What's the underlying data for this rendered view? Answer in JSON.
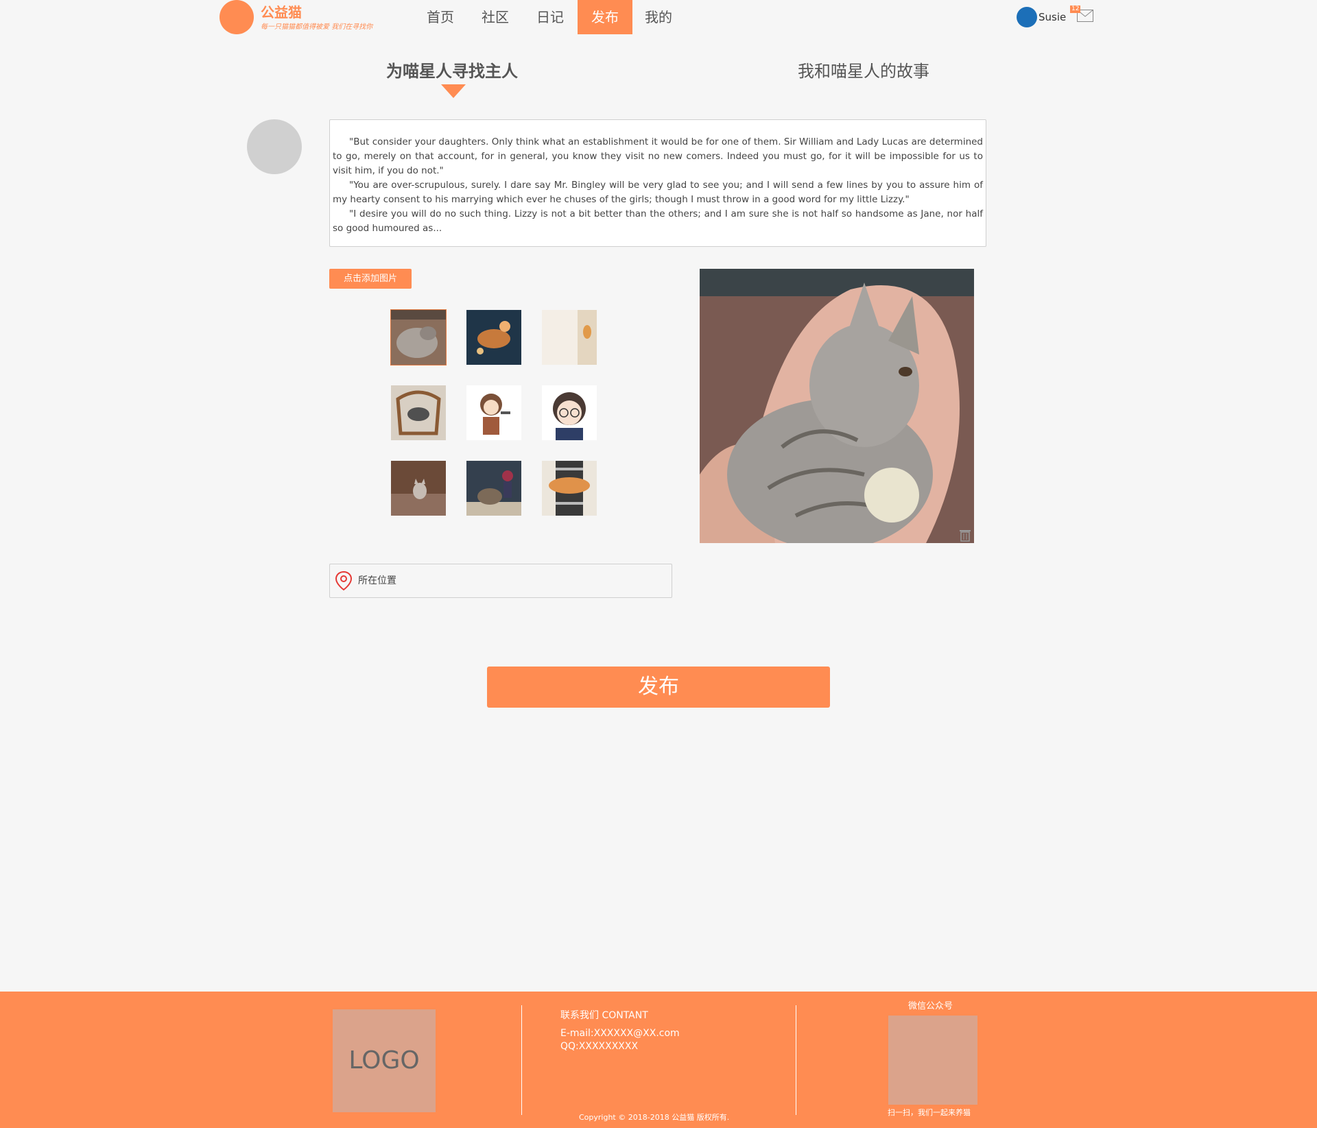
{
  "header": {
    "brand_name": "公益猫",
    "brand_slogan": "每一只猫猫都值得被爱 我们在寻找你",
    "nav": [
      "首页",
      "社区",
      "日记",
      "发布",
      "我的"
    ],
    "active_nav": "发布",
    "user_name": "Susie",
    "mail_badge": "12"
  },
  "tabs": {
    "find_owner": "为喵星人寻找主人",
    "stories": "我和喵星人的故事"
  },
  "post": {
    "paragraphs": [
      "\"But consider your daughters. Only think what an establishment it would be for one of them. Sir William and Lady Lucas are determined to go, merely on that account, for in general, you know they visit no new comers. Indeed you must go, for it will be impossible for us to visit him, if you do not.\"",
      "\"You are over-scrupulous, surely. I dare say Mr. Bingley will be very glad to see you; and I will send a few lines by you to assure him of my hearty consent to his marrying which ever he chuses of the girls; though I must throw in a good word for my little Lizzy.\"",
      "\"I desire you will do no such thing. Lizzy is not a bit better than the others; and I am sure she is not half so handsome as Jane, nor half so good humoured as..."
    ],
    "add_image_label": "点击添加图片",
    "location_placeholder": "所在位置",
    "publish_label": "发布"
  },
  "gallery": {
    "thumbnails": [
      "tabby-cat-photo",
      "cat-in-lights-photo",
      "orange-cat-doorway-photo",
      "cat-on-chair-photo",
      "anime-boy-sticker",
      "glasses-boy-sticker",
      "kitten-on-sofa-photo",
      "cat-toy-figure-photo",
      "person-holding-orange-cat-photo"
    ],
    "selected_index": 0
  },
  "footer": {
    "logo_text": "LOGO",
    "contact_title": "联系我们 CONTANT",
    "email": "E-mail:XXXXXX@XX.com",
    "qq": "QQ:XXXXXXXXX",
    "copyright": "Copyright © 2018-2018 公益猫 版权所有.",
    "wechat_title": "微信公众号",
    "qr_caption": "扫一扫，我们一起来养猫"
  },
  "colors": {
    "accent": "#ff8c52",
    "avatar": "#1c6fb8",
    "background": "#f6f6f6",
    "footer_block": "#dba38b"
  }
}
